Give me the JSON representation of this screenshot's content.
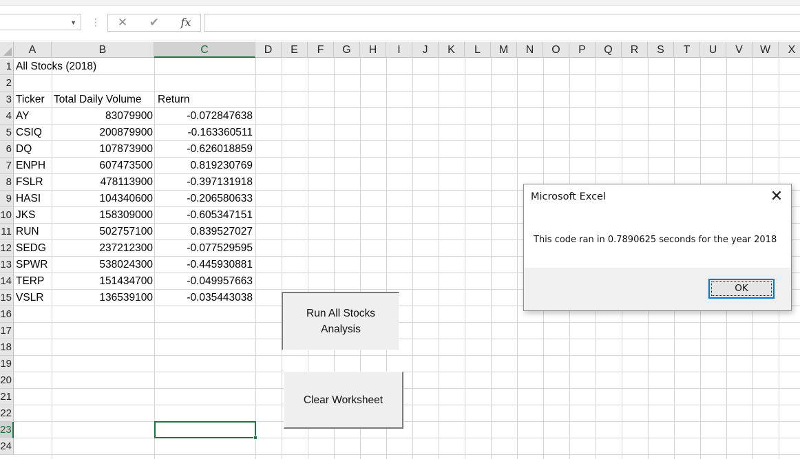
{
  "formula_bar": {
    "name_box_value": "",
    "cancel_icon": "✕",
    "enter_icon": "✔",
    "function_icon": "fx",
    "formula_value": ""
  },
  "columns": [
    "A",
    "B",
    "C",
    "D",
    "E",
    "F",
    "G",
    "H",
    "I",
    "J",
    "K",
    "L",
    "M",
    "N",
    "O",
    "P",
    "Q",
    "R",
    "S",
    "T",
    "U",
    "V",
    "W",
    "X"
  ],
  "selected_column": "C",
  "row_headers": [
    "1",
    "2",
    "3",
    "4",
    "5",
    "6",
    "7",
    "8",
    "9",
    "10",
    "11",
    "12",
    "13",
    "14",
    "15",
    "16",
    "17",
    "18",
    "19",
    "20",
    "21",
    "22",
    "23",
    "24"
  ],
  "selected_row": "23",
  "sheet": {
    "title": "All Stocks (2018)",
    "headers": {
      "ticker": "Ticker",
      "volume": "Total Daily Volume",
      "return": "Return"
    },
    "rows": [
      {
        "ticker": "AY",
        "volume": "83079900",
        "return": "-0.072847638"
      },
      {
        "ticker": "CSIQ",
        "volume": "200879900",
        "return": "-0.163360511"
      },
      {
        "ticker": "DQ",
        "volume": "107873900",
        "return": "-0.626018859"
      },
      {
        "ticker": "ENPH",
        "volume": "607473500",
        "return": "0.819230769"
      },
      {
        "ticker": "FSLR",
        "volume": "478113900",
        "return": "-0.397131918"
      },
      {
        "ticker": "HASI",
        "volume": "104340600",
        "return": "-0.206580633"
      },
      {
        "ticker": "JKS",
        "volume": "158309000",
        "return": "-0.605347151"
      },
      {
        "ticker": "RUN",
        "volume": "502757100",
        "return": "0.839527027"
      },
      {
        "ticker": "SEDG",
        "volume": "237212300",
        "return": "-0.077529595"
      },
      {
        "ticker": "SPWR",
        "volume": "538024300",
        "return": "-0.445930881"
      },
      {
        "ticker": "TERP",
        "volume": "151434700",
        "return": "-0.049957663"
      },
      {
        "ticker": "VSLR",
        "volume": "136539100",
        "return": "-0.035443038"
      }
    ]
  },
  "buttons": {
    "run_line1": "Run All Stocks",
    "run_line2": "Analysis",
    "clear": "Clear Worksheet"
  },
  "dialog": {
    "title": "Microsoft Excel",
    "close_icon": "✕",
    "message": "This code ran in 0.7890625 seconds for the year 2018",
    "ok_label": "OK"
  },
  "colors": {
    "selection_green": "#217346",
    "header_gray": "#e6e6e6",
    "gridline": "#d4d4d4",
    "dialog_focus_blue": "#0078d7"
  }
}
